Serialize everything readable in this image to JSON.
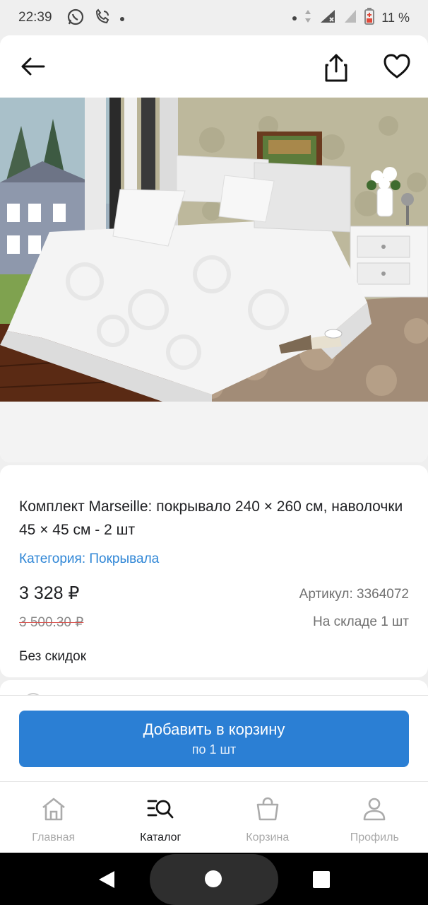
{
  "status_bar": {
    "time": "22:39",
    "battery_percent": "11 %",
    "icons": [
      "whatsapp-icon",
      "phone-wifi-icon",
      "dot",
      "dot",
      "data-arrows-icon",
      "signal-icon",
      "wifi-signal-icon",
      "battery-low-icon"
    ]
  },
  "header": {
    "icons": [
      "arrow-left-icon",
      "share-icon",
      "heart-icon"
    ]
  },
  "product": {
    "title": "Комплект Marseille: покрывало 240 × 260 см, наволочки 45 × 45 см - 2 шт",
    "category": "Категория: Покрывала",
    "price": "3 328 ₽",
    "old_price": "3 500.30 ₽",
    "sku": "Артикул: 3364072",
    "stock": "На складе 1 шт",
    "discount_note": "Без скидок",
    "image_subject": "white-bedspread-bedroom-photo"
  },
  "cart": {
    "button_label": "Добавить в корзину",
    "button_sublabel": "по 1 шт"
  },
  "bottom_nav": {
    "items": [
      {
        "label": "Главная",
        "icon": "home-icon",
        "active": false
      },
      {
        "label": "Каталог",
        "icon": "catalog-search-icon",
        "active": true
      },
      {
        "label": "Корзина",
        "icon": "shopping-bag-icon",
        "active": false
      },
      {
        "label": "Профиль",
        "icon": "user-icon",
        "active": false
      }
    ]
  },
  "colors": {
    "accent": "#2b7fd4",
    "link": "#2f86d6",
    "background": "#efefef",
    "strike": "#d9534f"
  }
}
